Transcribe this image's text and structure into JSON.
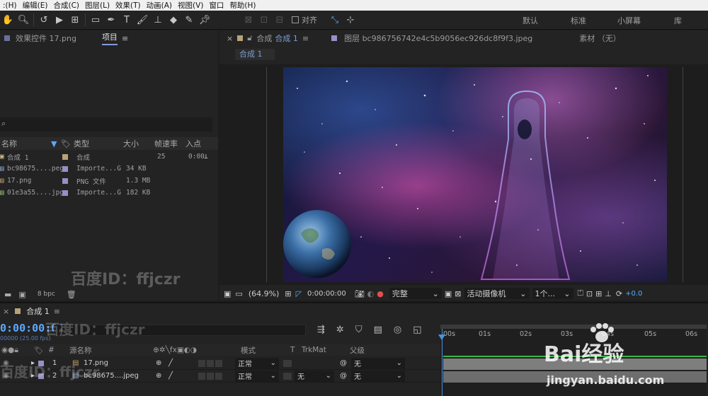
{
  "menu": [
    ":(H)",
    "编辑(E)",
    "合成(C)",
    "图层(L)",
    "效果(T)",
    "动画(A)",
    "视图(V)",
    "窗口",
    "帮助(H)"
  ],
  "toolbar": {
    "align_label": "对齐",
    "workspaces": [
      "默认",
      "标准",
      "小屏幕",
      "库"
    ]
  },
  "project_panel": {
    "tabs": [
      "效果控件 17.png",
      "项目"
    ],
    "columns": [
      "名称",
      "类型",
      "大小",
      "帧速率",
      "入点"
    ],
    "items": [
      {
        "name": "合成 1",
        "type": "合成",
        "size": "",
        "fps": "25",
        "in": "0:00",
        "color": "#b8a27a"
      },
      {
        "name": "bc98675....peg",
        "type": "Importe...G",
        "size": "34 KB",
        "fps": "",
        "in": "",
        "color": "#9a8ec7"
      },
      {
        "name": "17.png",
        "type": "PNG 文件",
        "size": "1.3 MB",
        "fps": "",
        "in": "",
        "color": "#9a8ec7"
      },
      {
        "name": "01e3a55....jpg",
        "type": "Importe...G",
        "size": "182 KB",
        "fps": "",
        "in": "",
        "color": "#9a8ec7"
      }
    ],
    "bpc": "8 bpc"
  },
  "viewer": {
    "tabs": [
      "合成",
      "合成 1",
      "图层 bc986756742e4c5b9056ec926dc8f9f3.jpeg",
      "素材 （无）"
    ],
    "subtab": "合成 1",
    "zoom": "(64.9%)",
    "timecode": "0:00:00:00",
    "resolution": "完整",
    "camera": "活动摄像机",
    "views": "1个...",
    "exposure": "+0.0"
  },
  "timeline": {
    "tab": "合成 1",
    "timecode": "0:00:00:00",
    "fps_note": "00000 (25.00 fps)",
    "search_placeholder": "",
    "columns": [
      "#",
      "源名称",
      "模式",
      "T",
      "TrkMat",
      "父级"
    ],
    "ruler": [
      "00s",
      "01s",
      "02s",
      "03s",
      "04s",
      "05s",
      "06s"
    ],
    "layers": [
      {
        "num": "1",
        "name": "17.png",
        "mode": "正常",
        "trkmat": "",
        "parent": "无"
      },
      {
        "num": "2",
        "name": "bc98675....jpeg",
        "mode": "正常",
        "trkmat": "无",
        "parent": "无"
      }
    ]
  },
  "watermarks": {
    "text": "百度ID：ffjczr",
    "baidu": "Bai经验",
    "url": "jingyan.baidu.com"
  }
}
